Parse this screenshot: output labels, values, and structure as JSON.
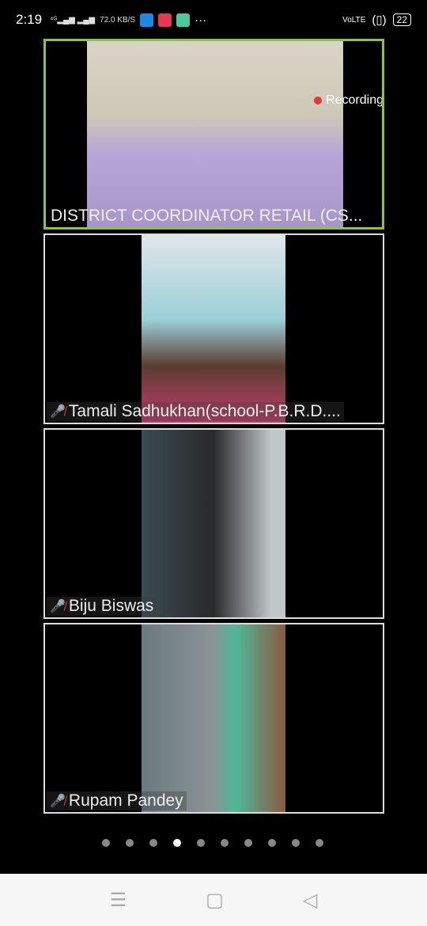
{
  "status_bar": {
    "time": "2:19",
    "network": "4G",
    "speed": "72.0 KB/S",
    "more": "···",
    "volte": "VoLTE",
    "battery": "22"
  },
  "recording": {
    "label": "Recording",
    "color": "#e53935"
  },
  "participants": [
    {
      "name": "DISTRICT COORDINATOR RETAIL (CS...",
      "muted": false,
      "active_speaker": true
    },
    {
      "name": "Tamali Sadhukhan(school-P.B.R.D....",
      "muted": true
    },
    {
      "name": "Biju Biswas",
      "muted": true
    },
    {
      "name": "Rupam Pandey",
      "muted": true
    }
  ],
  "pagination": {
    "total": 10,
    "current": 4
  },
  "nav": {
    "menu": "menu-icon",
    "home": "home-icon",
    "back": "back-icon"
  },
  "colors": {
    "active_border": "#8bc34a",
    "mute": "#e33"
  }
}
